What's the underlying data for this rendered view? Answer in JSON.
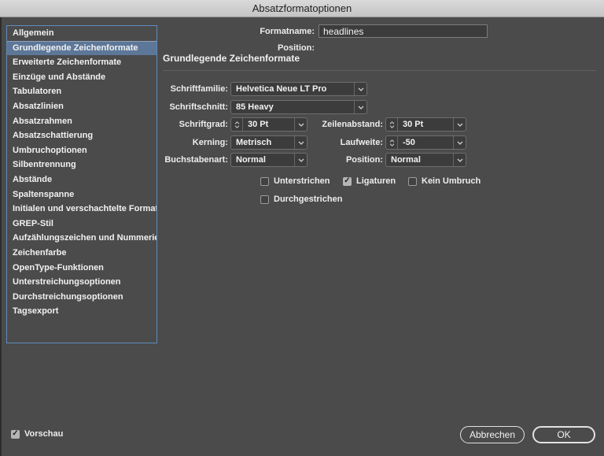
{
  "window": {
    "title": "Absatzformatoptionen"
  },
  "sidebar": {
    "items": [
      {
        "label": "Allgemein",
        "selected": false
      },
      {
        "label": "Grundlegende Zeichenformate",
        "selected": true
      },
      {
        "label": "Erweiterte Zeichenformate",
        "selected": false
      },
      {
        "label": "Einzüge und Abstände",
        "selected": false
      },
      {
        "label": "Tabulatoren",
        "selected": false
      },
      {
        "label": "Absatzlinien",
        "selected": false
      },
      {
        "label": "Absatzrahmen",
        "selected": false
      },
      {
        "label": "Absatzschattierung",
        "selected": false
      },
      {
        "label": "Umbruchoptionen",
        "selected": false
      },
      {
        "label": "Silbentrennung",
        "selected": false
      },
      {
        "label": "Abstände",
        "selected": false
      },
      {
        "label": "Spaltenspanne",
        "selected": false
      },
      {
        "label": "Initialen und verschachtelte Formate",
        "selected": false
      },
      {
        "label": "GREP-Stil",
        "selected": false
      },
      {
        "label": "Aufzählungszeichen und Nummerierung",
        "selected": false
      },
      {
        "label": "Zeichenfarbe",
        "selected": false
      },
      {
        "label": "OpenType-Funktionen",
        "selected": false
      },
      {
        "label": "Unterstreichungsoptionen",
        "selected": false
      },
      {
        "label": "Durchstreichungsoptionen",
        "selected": false
      },
      {
        "label": "Tagsexport",
        "selected": false
      }
    ]
  },
  "header": {
    "format_name_label": "Formatname:",
    "format_name_value": "headlines",
    "position_label": "Position:",
    "section_title": "Grundlegende Zeichenformate"
  },
  "form": {
    "font_family": {
      "label": "Schriftfamilie:",
      "value": "Helvetica Neue LT Pro"
    },
    "font_style": {
      "label": "Schriftschnitt:",
      "value": "85 Heavy"
    },
    "font_size": {
      "label": "Schriftgrad:",
      "value": "30 Pt"
    },
    "leading": {
      "label": "Zeilenabstand:",
      "value": "30 Pt"
    },
    "kerning": {
      "label": "Kerning:",
      "value": "Metrisch"
    },
    "tracking": {
      "label": "Laufweite:",
      "value": "-50"
    },
    "case": {
      "label": "Buchstabenart:",
      "value": "Normal"
    },
    "position": {
      "label": "Position:",
      "value": "Normal"
    }
  },
  "checkboxes": {
    "underline": {
      "label": "Unterstrichen",
      "checked": false
    },
    "ligatures": {
      "label": "Ligaturen",
      "checked": true
    },
    "no_break": {
      "label": "Kein Umbruch",
      "checked": false
    },
    "strikethrough": {
      "label": "Durchgestrichen",
      "checked": false
    }
  },
  "footer": {
    "preview": {
      "label": "Vorschau",
      "checked": true
    },
    "cancel_label": "Abbrechen",
    "ok_label": "OK"
  },
  "colors": {
    "selection_blue": "#5d7798",
    "sidebar_border_blue": "#5e8cba",
    "dialog_background": "#4b4b4b",
    "field_background": "#3c3c3c",
    "titlebar_gradient_top": "#dadada",
    "titlebar_gradient_bottom": "#c4c4c4"
  }
}
